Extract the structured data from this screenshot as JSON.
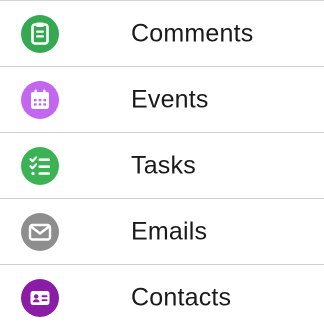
{
  "list": {
    "items": [
      {
        "label": "Comments",
        "icon": "clipboard-icon",
        "color": "#36a852"
      },
      {
        "label": "Events",
        "icon": "calendar-icon",
        "color": "#c367f0"
      },
      {
        "label": "Tasks",
        "icon": "checklist-icon",
        "color": "#3bb253"
      },
      {
        "label": "Emails",
        "icon": "envelope-icon",
        "color": "#8e8e8e"
      },
      {
        "label": "Contacts",
        "icon": "contact-card-icon",
        "color": "#8b1ca6"
      }
    ]
  }
}
